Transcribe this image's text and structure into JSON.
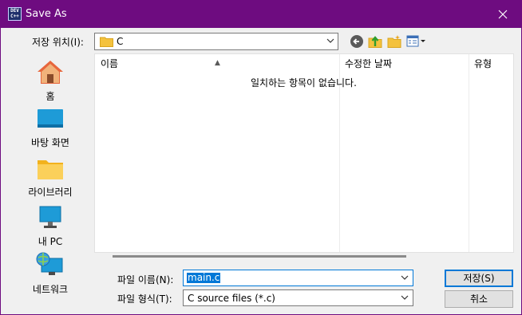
{
  "window": {
    "title": "Save As",
    "app_icon_text": "DEV C++"
  },
  "toolbar": {
    "location_label": "저장 위치(I):",
    "location_value": "C"
  },
  "places": [
    {
      "label": "홈",
      "icon": "home-icon"
    },
    {
      "label": "바탕 화면",
      "icon": "desktop-icon"
    },
    {
      "label": "라이브러리",
      "icon": "libraries-folder-icon"
    },
    {
      "label": "내 PC",
      "icon": "this-pc-icon"
    },
    {
      "label": "네트워크",
      "icon": "network-icon"
    }
  ],
  "filelist": {
    "columns": [
      "이름",
      "수정한 날짜",
      "유형"
    ],
    "empty_message": "일치하는 항목이 없습니다."
  },
  "form": {
    "filename_label": "파일 이름(N):",
    "filename_value": "main.c",
    "filetype_label": "파일 형식(T):",
    "filetype_value": "C source files (*.c)"
  },
  "buttons": {
    "save": "저장(S)",
    "cancel": "취소"
  },
  "colors": {
    "titlebar": "#6e0c80",
    "accent": "#0078d7"
  }
}
